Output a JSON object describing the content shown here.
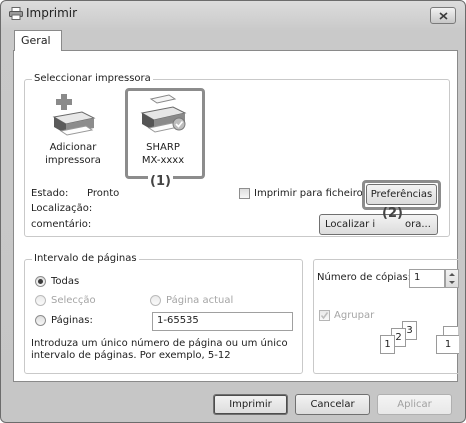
{
  "window": {
    "title": "Imprimir",
    "icon": "printer-icon"
  },
  "tab": {
    "label": "Geral"
  },
  "select_printer": {
    "label": "Seleccionar impressora",
    "devices": [
      {
        "label_line1": "Adicionar",
        "label_line2": "impressora",
        "icon": "add-printer-icon"
      },
      {
        "label_line1": "SHARP",
        "label_line2": "MX-xxxx",
        "icon": "printer-icon"
      }
    ],
    "status_label": "Estado:",
    "status_value": "Pronto",
    "location_label": "Localização:",
    "comment_label": "comentário:",
    "print_to_file_label": "Imprimir para ficheiro",
    "preferences_button": "Preferências",
    "find_printer_button_left": "Localizar i",
    "find_printer_button_right": "ora..."
  },
  "callouts": {
    "one": "(1)",
    "two": "(2)"
  },
  "page_range": {
    "label": "Intervalo de páginas",
    "all": "Todas",
    "selection": "Selecção",
    "current_page": "Página actual",
    "pages": "Páginas:",
    "pages_value": "1-65535",
    "help_line1": "Introduza um único número de página ou um único",
    "help_line2": "intervalo de páginas. Por exemplo, 5-12"
  },
  "copies": {
    "label": "Número de cópias:",
    "value": "1",
    "collate_label": "Agrupar",
    "collate_pages": [
      "1",
      "2",
      "3",
      "1"
    ]
  },
  "footer": {
    "print": "Imprimir",
    "cancel": "Cancelar",
    "apply": "Aplicar"
  }
}
